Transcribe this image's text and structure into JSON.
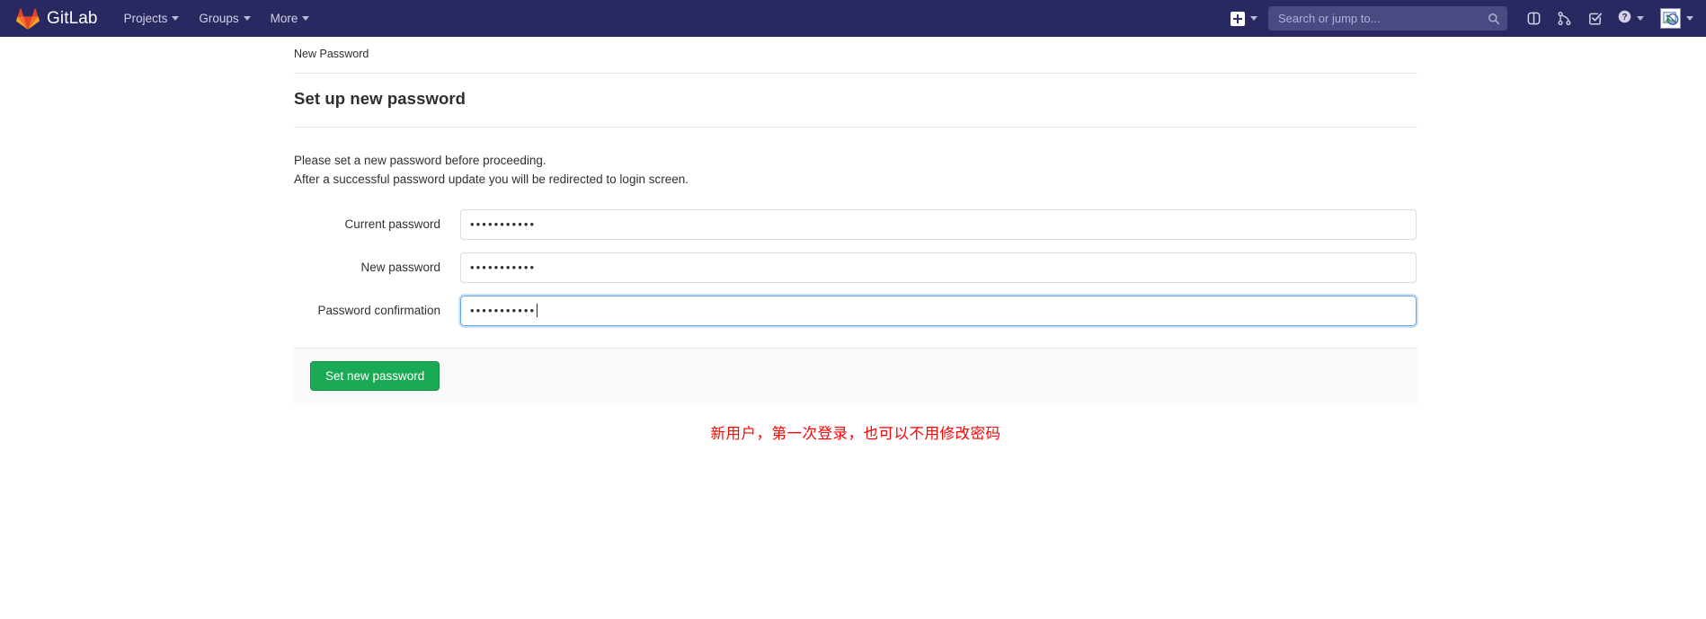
{
  "navbar": {
    "brand": "GitLab",
    "logo_icon": "gitlab-fox-logo",
    "items": [
      {
        "label": "Projects",
        "icon": "chevron-down-icon"
      },
      {
        "label": "Groups",
        "icon": "chevron-down-icon"
      },
      {
        "label": "More",
        "icon": "chevron-down-icon"
      }
    ],
    "create_new": {
      "icon": "plus-square-icon",
      "chevron": "chevron-down-icon"
    },
    "search": {
      "placeholder": "Search or jump to...",
      "value": "",
      "icon": "search-icon"
    },
    "actions": [
      {
        "name": "issues",
        "icon": "issues-icon"
      },
      {
        "name": "merge-requests",
        "icon": "merge-request-icon"
      },
      {
        "name": "todos",
        "icon": "todo-checkbox-icon"
      }
    ],
    "help": {
      "icon": "question-circle-icon",
      "chevron": "chevron-down-icon"
    },
    "user": {
      "icon": "broken-image-avatar-icon",
      "chevron": "chevron-down-icon"
    },
    "background_color": "#292961"
  },
  "main": {
    "breadcrumb": "New Password",
    "page_title": "Set up new password",
    "intro_lines": [
      "Please set a new password before proceeding.",
      "After a successful password update you will be redirected to login screen."
    ],
    "fields": [
      {
        "label": "Current password",
        "value": "•••••••••••",
        "focused": false
      },
      {
        "label": "New password",
        "value": "•••••••••••",
        "focused": false
      },
      {
        "label": "Password confirmation",
        "value": "•••••••••••",
        "focused": true
      }
    ],
    "submit_label": "Set new password",
    "submit_color": "#1aaa55"
  },
  "annotation": {
    "text": "新用户，第一次登录，也可以不用修改密码",
    "color": "#ff0000"
  }
}
